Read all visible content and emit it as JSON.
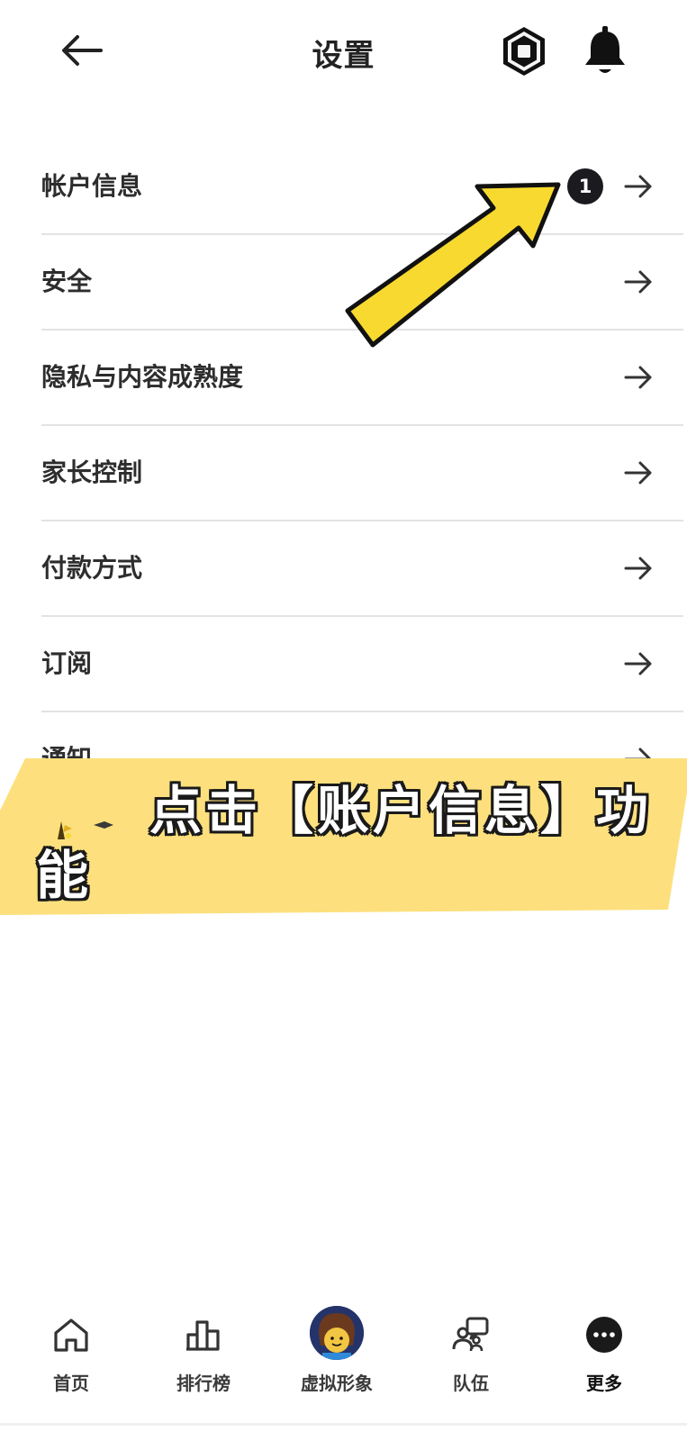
{
  "header": {
    "title": "设置"
  },
  "settings": {
    "items": [
      {
        "label": "帐户信息",
        "badge": "1"
      },
      {
        "label": "安全"
      },
      {
        "label": "隐私与内容成熟度"
      },
      {
        "label": "家长控制"
      },
      {
        "label": "付款方式"
      },
      {
        "label": "订阅"
      },
      {
        "label": "通知"
      }
    ]
  },
  "caption": {
    "text": "点击【账户信息】功能"
  },
  "nav": {
    "items": [
      {
        "label": "首页",
        "icon": "home-icon"
      },
      {
        "label": "排行榜",
        "icon": "chart-icon"
      },
      {
        "label": "虚拟形象",
        "icon": "avatar"
      },
      {
        "label": "队伍",
        "icon": "group-icon"
      },
      {
        "label": "更多",
        "icon": "more-icon",
        "active": true
      }
    ]
  },
  "colors": {
    "accent_yellow": "#f8d92f",
    "banner_yellow": "#fde07d",
    "badge": "#1b1b1f",
    "divider": "#e3e3e3"
  }
}
